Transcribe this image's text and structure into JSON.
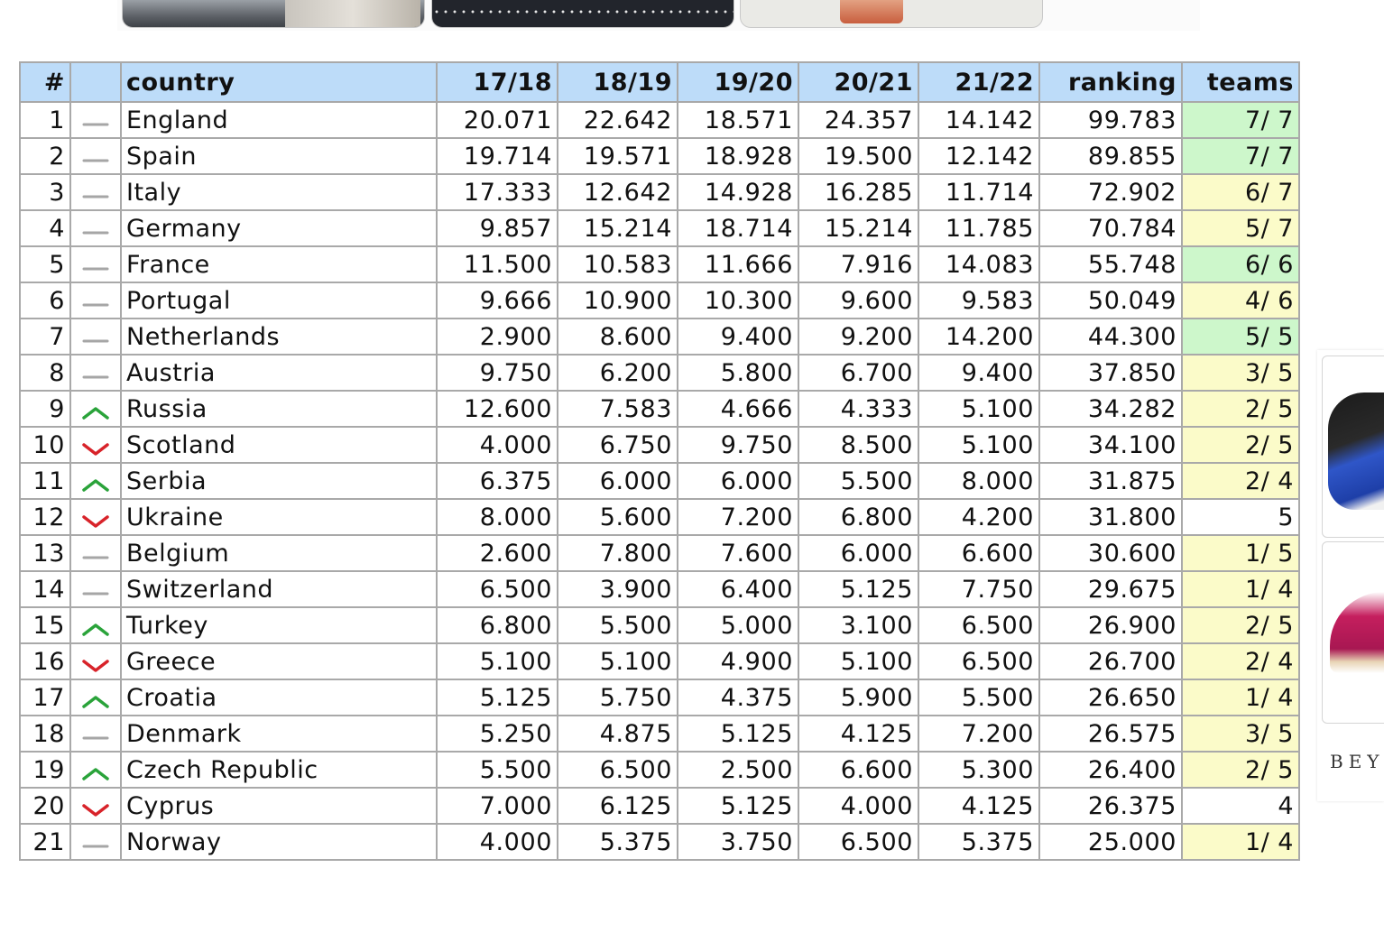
{
  "table": {
    "headers": [
      "#",
      "",
      "country",
      "17/18",
      "18/19",
      "19/20",
      "20/21",
      "21/22",
      "ranking",
      "teams"
    ],
    "rows": [
      {
        "rank": "1",
        "trend": "same",
        "country": "England",
        "y1": "20.071",
        "y2": "22.642",
        "y3": "18.571",
        "y4": "24.357",
        "y5": "14.142",
        "ranking": "99.783",
        "teams": "7/ 7",
        "teams_status": "full"
      },
      {
        "rank": "2",
        "trend": "same",
        "country": "Spain",
        "y1": "19.714",
        "y2": "19.571",
        "y3": "18.928",
        "y4": "19.500",
        "y5": "12.142",
        "ranking": "89.855",
        "teams": "7/ 7",
        "teams_status": "full"
      },
      {
        "rank": "3",
        "trend": "same",
        "country": "Italy",
        "y1": "17.333",
        "y2": "12.642",
        "y3": "14.928",
        "y4": "16.285",
        "y5": "11.714",
        "ranking": "72.902",
        "teams": "6/ 7",
        "teams_status": "part"
      },
      {
        "rank": "4",
        "trend": "same",
        "country": "Germany",
        "y1": "9.857",
        "y2": "15.214",
        "y3": "18.714",
        "y4": "15.214",
        "y5": "11.785",
        "ranking": "70.784",
        "teams": "5/ 7",
        "teams_status": "part"
      },
      {
        "rank": "5",
        "trend": "same",
        "country": "France",
        "y1": "11.500",
        "y2": "10.583",
        "y3": "11.666",
        "y4": "7.916",
        "y5": "14.083",
        "ranking": "55.748",
        "teams": "6/ 6",
        "teams_status": "full"
      },
      {
        "rank": "6",
        "trend": "same",
        "country": "Portugal",
        "y1": "9.666",
        "y2": "10.900",
        "y3": "10.300",
        "y4": "9.600",
        "y5": "9.583",
        "ranking": "50.049",
        "teams": "4/ 6",
        "teams_status": "part"
      },
      {
        "rank": "7",
        "trend": "same",
        "country": "Netherlands",
        "y1": "2.900",
        "y2": "8.600",
        "y3": "9.400",
        "y4": "9.200",
        "y5": "14.200",
        "ranking": "44.300",
        "teams": "5/ 5",
        "teams_status": "full"
      },
      {
        "rank": "8",
        "trend": "same",
        "country": "Austria",
        "y1": "9.750",
        "y2": "6.200",
        "y3": "5.800",
        "y4": "6.700",
        "y5": "9.400",
        "ranking": "37.850",
        "teams": "3/ 5",
        "teams_status": "part"
      },
      {
        "rank": "9",
        "trend": "up",
        "country": "Russia",
        "y1": "12.600",
        "y2": "7.583",
        "y3": "4.666",
        "y4": "4.333",
        "y5": "5.100",
        "ranking": "34.282",
        "teams": "2/ 5",
        "teams_status": "part"
      },
      {
        "rank": "10",
        "trend": "down",
        "country": "Scotland",
        "y1": "4.000",
        "y2": "6.750",
        "y3": "9.750",
        "y4": "8.500",
        "y5": "5.100",
        "ranking": "34.100",
        "teams": "2/ 5",
        "teams_status": "part"
      },
      {
        "rank": "11",
        "trend": "up",
        "country": "Serbia",
        "y1": "6.375",
        "y2": "6.000",
        "y3": "6.000",
        "y4": "5.500",
        "y5": "8.000",
        "ranking": "31.875",
        "teams": "2/ 4",
        "teams_status": "part"
      },
      {
        "rank": "12",
        "trend": "down",
        "country": "Ukraine",
        "y1": "8.000",
        "y2": "5.600",
        "y3": "7.200",
        "y4": "6.800",
        "y5": "4.200",
        "ranking": "31.800",
        "teams": "5",
        "teams_status": "none"
      },
      {
        "rank": "13",
        "trend": "same",
        "country": "Belgium",
        "y1": "2.600",
        "y2": "7.800",
        "y3": "7.600",
        "y4": "6.000",
        "y5": "6.600",
        "ranking": "30.600",
        "teams": "1/ 5",
        "teams_status": "part"
      },
      {
        "rank": "14",
        "trend": "same",
        "country": "Switzerland",
        "y1": "6.500",
        "y2": "3.900",
        "y3": "6.400",
        "y4": "5.125",
        "y5": "7.750",
        "ranking": "29.675",
        "teams": "1/ 4",
        "teams_status": "part"
      },
      {
        "rank": "15",
        "trend": "up",
        "country": "Turkey",
        "y1": "6.800",
        "y2": "5.500",
        "y3": "5.000",
        "y4": "3.100",
        "y5": "6.500",
        "ranking": "26.900",
        "teams": "2/ 5",
        "teams_status": "part"
      },
      {
        "rank": "16",
        "trend": "down",
        "country": "Greece",
        "y1": "5.100",
        "y2": "5.100",
        "y3": "4.900",
        "y4": "5.100",
        "y5": "6.500",
        "ranking": "26.700",
        "teams": "2/ 4",
        "teams_status": "part"
      },
      {
        "rank": "17",
        "trend": "up",
        "country": "Croatia",
        "y1": "5.125",
        "y2": "5.750",
        "y3": "4.375",
        "y4": "5.900",
        "y5": "5.500",
        "ranking": "26.650",
        "teams": "1/ 4",
        "teams_status": "part"
      },
      {
        "rank": "18",
        "trend": "same",
        "country": "Denmark",
        "y1": "5.250",
        "y2": "4.875",
        "y3": "5.125",
        "y4": "4.125",
        "y5": "7.200",
        "ranking": "26.575",
        "teams": "3/ 5",
        "teams_status": "part"
      },
      {
        "rank": "19",
        "trend": "up",
        "country": "Czech Republic",
        "y1": "5.500",
        "y2": "6.500",
        "y3": "2.500",
        "y4": "6.600",
        "y5": "5.300",
        "ranking": "26.400",
        "teams": "2/ 5",
        "teams_status": "part"
      },
      {
        "rank": "20",
        "trend": "down",
        "country": "Cyprus",
        "y1": "7.000",
        "y2": "6.125",
        "y3": "5.125",
        "y4": "4.000",
        "y5": "4.125",
        "ranking": "26.375",
        "teams": "4",
        "teams_status": "none"
      },
      {
        "rank": "21",
        "trend": "same",
        "country": "Norway",
        "y1": "4.000",
        "y2": "5.375",
        "y3": "3.750",
        "y4": "6.500",
        "y5": "5.375",
        "ranking": "25.000",
        "teams": "1/ 4",
        "teams_status": "part"
      }
    ]
  },
  "side_ad": {
    "brand_text": "BEY"
  },
  "colors": {
    "header_bg": "#bddcf9",
    "teams_full": "#cdf7cb",
    "teams_partial": "#fbfbc9",
    "trend_up": "#2aa33a",
    "trend_down": "#d8232a",
    "trend_same": "#a6a6a6",
    "border": "#a9a9a9"
  },
  "icons": {
    "up": "chevron-up-icon",
    "down": "chevron-down-icon",
    "same": "dash-icon"
  }
}
